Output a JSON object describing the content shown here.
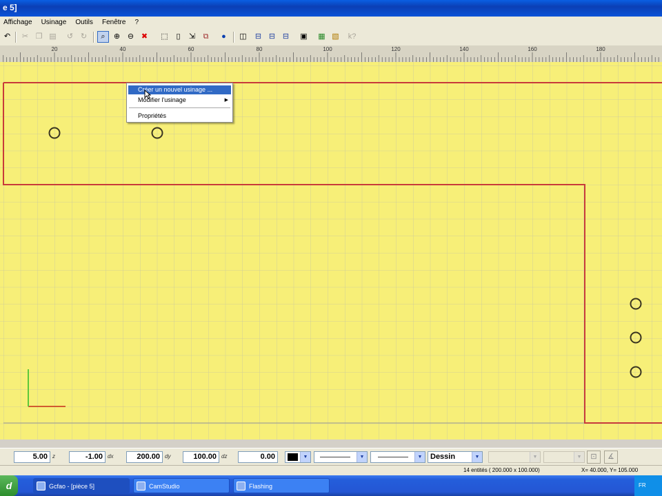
{
  "window": {
    "title": "e 5]"
  },
  "menu": [
    "Affichage",
    "Usinage",
    "Outils",
    "Fenêtre",
    "?"
  ],
  "toolbar": {
    "help_label": "k?"
  },
  "ruler": {
    "labels": [
      "20",
      "40",
      "60",
      "80",
      "100",
      "120",
      "140",
      "160",
      "180"
    ]
  },
  "context_menu": {
    "items": [
      {
        "label": "Créer un nouvel usinage ...",
        "highlighted": true,
        "submenu": false
      },
      {
        "label": "Modifier l'usinage",
        "highlighted": false,
        "submenu": true
      },
      {
        "label": "Propriétés",
        "highlighted": false,
        "submenu": false
      }
    ]
  },
  "coords": {
    "z": {
      "value": "5.00",
      "label": "z"
    },
    "dx": {
      "value": "-1.00",
      "label": "dx"
    },
    "dy": {
      "value": "200.00",
      "label": "dy"
    },
    "dz": {
      "value": "100.00",
      "label": "dz"
    },
    "angle": {
      "value": "0.00"
    }
  },
  "layer": {
    "value": "Dessin"
  },
  "colors": {
    "canvas": "#f7ef78",
    "grid": "#c9c8a0",
    "profile": "#c83a3a",
    "hole": "#3a3520",
    "color_swatch": "#000000",
    "selection": "#316ac5"
  },
  "status": {
    "entities": "14 entités ( 200.000 x 100.000)",
    "x_coord": "X= 40.000, Y= 105.000"
  },
  "taskbar": {
    "start_label": "d",
    "tasks": [
      {
        "label": "Gcfao - [pièce 5]",
        "active": true
      },
      {
        "label": "CamStudio",
        "active": false
      },
      {
        "label": "Flashing",
        "active": false
      }
    ],
    "tray_lang": "FR"
  }
}
